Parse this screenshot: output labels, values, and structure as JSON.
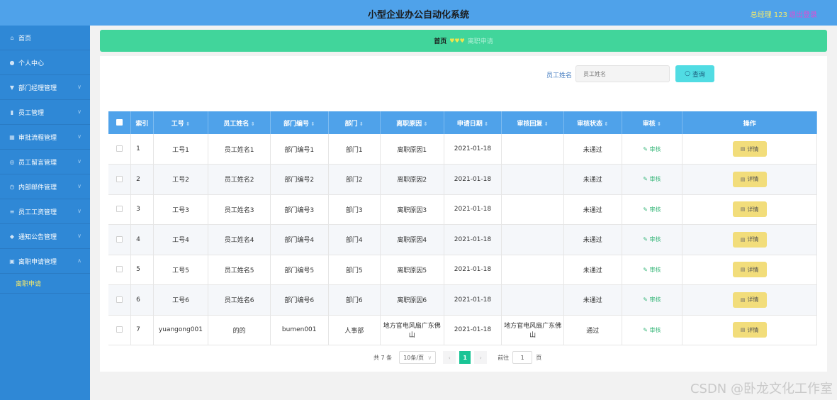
{
  "header": {
    "title": "小型企业办公自动化系统",
    "user": "总经理 123",
    "logout": "退出登录"
  },
  "sidebar": {
    "items": [
      {
        "label": "首页",
        "icon": "home-icon",
        "glyph": "⌂"
      },
      {
        "label": "个人中心",
        "icon": "user-icon",
        "glyph": "●"
      },
      {
        "label": "部门经理管理",
        "icon": "shield-icon",
        "glyph": "▼"
      },
      {
        "label": "员工管理",
        "icon": "bar-chart-icon",
        "glyph": "▮"
      },
      {
        "label": "审批流程管理",
        "icon": "flow-icon",
        "glyph": "▦"
      },
      {
        "label": "员工留言管理",
        "icon": "message-icon",
        "glyph": "◎"
      },
      {
        "label": "内部邮件管理",
        "icon": "mail-icon",
        "glyph": "◷"
      },
      {
        "label": "员工工资管理",
        "icon": "list-icon",
        "glyph": "≡"
      },
      {
        "label": "通知公告管理",
        "icon": "bell-icon",
        "glyph": "◆"
      },
      {
        "label": "离职申请管理",
        "icon": "grid-icon",
        "glyph": "▣"
      }
    ],
    "submenu": {
      "label": "离职申请"
    }
  },
  "breadcrumb": {
    "home": "首页",
    "sep": "♥♥♥",
    "current": "离职申请"
  },
  "search": {
    "label": "员工姓名",
    "placeholder": "员工姓名",
    "button": "查询"
  },
  "table": {
    "headers": [
      "索引",
      "工号",
      "员工姓名",
      "部门编号",
      "部门",
      "离职原因",
      "申请日期",
      "审核回复",
      "审核状态",
      "审核",
      "操作"
    ],
    "rows": [
      {
        "index": "1",
        "gonghao": "工号1",
        "name": "员工姓名1",
        "deptno": "部门编号1",
        "dept": "部门1",
        "reason": "离职原因1",
        "date": "2021-01-18",
        "reply": "",
        "status": "未通过",
        "audit": "审核",
        "detail": "详情"
      },
      {
        "index": "2",
        "gonghao": "工号2",
        "name": "员工姓名2",
        "deptno": "部门编号2",
        "dept": "部门2",
        "reason": "离职原因2",
        "date": "2021-01-18",
        "reply": "",
        "status": "未通过",
        "audit": "审核",
        "detail": "详情"
      },
      {
        "index": "3",
        "gonghao": "工号3",
        "name": "员工姓名3",
        "deptno": "部门编号3",
        "dept": "部门3",
        "reason": "离职原因3",
        "date": "2021-01-18",
        "reply": "",
        "status": "未通过",
        "audit": "审核",
        "detail": "详情"
      },
      {
        "index": "4",
        "gonghao": "工号4",
        "name": "员工姓名4",
        "deptno": "部门编号4",
        "dept": "部门4",
        "reason": "离职原因4",
        "date": "2021-01-18",
        "reply": "",
        "status": "未通过",
        "audit": "审核",
        "detail": "详情"
      },
      {
        "index": "5",
        "gonghao": "工号5",
        "name": "员工姓名5",
        "deptno": "部门编号5",
        "dept": "部门5",
        "reason": "离职原因5",
        "date": "2021-01-18",
        "reply": "",
        "status": "未通过",
        "audit": "审核",
        "detail": "详情"
      },
      {
        "index": "6",
        "gonghao": "工号6",
        "name": "员工姓名6",
        "deptno": "部门编号6",
        "dept": "部门6",
        "reason": "离职原因6",
        "date": "2021-01-18",
        "reply": "",
        "status": "未通过",
        "audit": "审核",
        "detail": "详情"
      },
      {
        "index": "7",
        "gonghao": "yuangong001",
        "name": "的的",
        "deptno": "bumen001",
        "dept": "人事部",
        "reason": "地方官电风扇广东佛山",
        "date": "2021-01-18",
        "reply": "地方官电风扇广东佛山",
        "status": "通过",
        "audit": "审核",
        "detail": "详情"
      }
    ]
  },
  "pagination": {
    "total": "共 7 条",
    "page_size": "10条/页",
    "current": "1",
    "goto_label": "前往",
    "goto_value": "1",
    "page_suffix": "页"
  },
  "watermark": "CSDN @卧龙文化工作室",
  "colors": {
    "topbar": "#4fa2ea",
    "sidebar": "#2f88d6",
    "breadcrumb": "#41d59b",
    "search_button": "#51dce3",
    "detail_button": "#f2dd7b",
    "active_page": "#19c495"
  }
}
